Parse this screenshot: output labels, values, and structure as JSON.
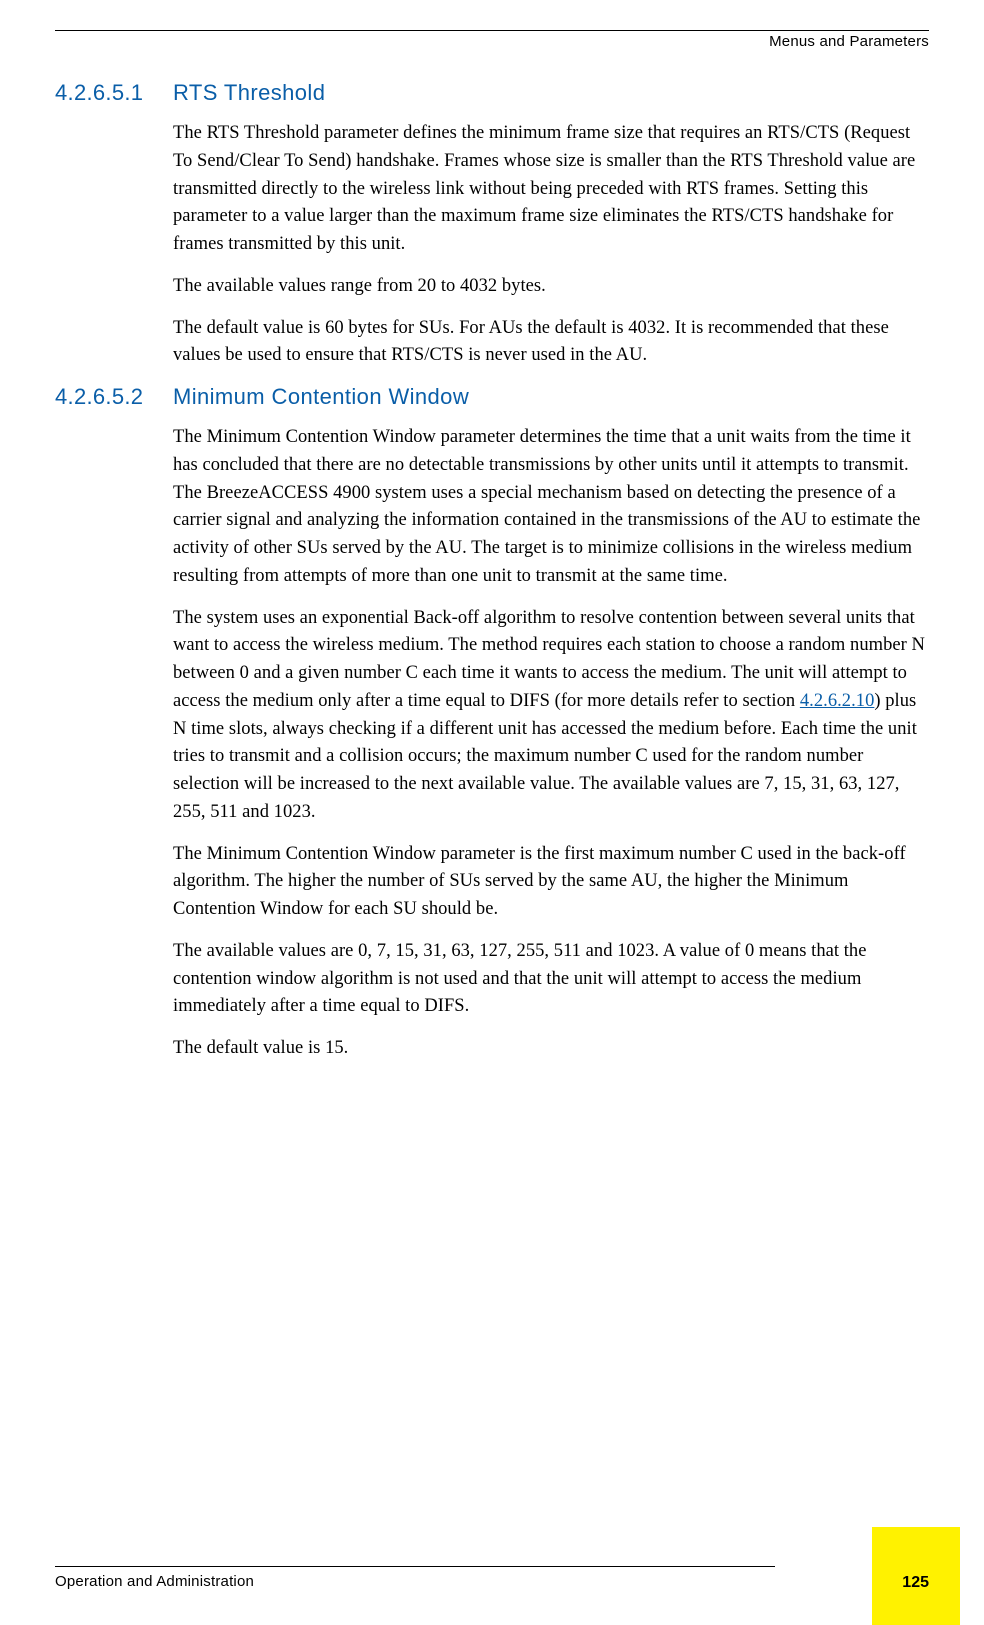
{
  "header": {
    "running_head": "Menus and Parameters"
  },
  "sections": {
    "s1": {
      "num": "4.2.6.5.1",
      "title": "RTS Threshold",
      "p1": "The RTS Threshold parameter defines the minimum frame size that requires an RTS/CTS (Request To Send/Clear To Send) handshake. Frames whose size is smaller than the RTS Threshold value are transmitted directly to the wireless link without being preceded with RTS frames. Setting this parameter to a value larger than the maximum frame size eliminates the RTS/CTS handshake for frames transmitted by this unit.",
      "p2": "The available values range from 20 to 4032 bytes.",
      "p3": "The default value is 60 bytes for SUs. For AUs the default is 4032. It is recommended that these values be used to ensure that RTS/CTS is never used in the AU."
    },
    "s2": {
      "num": "4.2.6.5.2",
      "title": "Minimum Contention Window",
      "p1": "The Minimum Contention Window parameter determines the time that a unit waits from the time it has concluded that there are no detectable transmissions by other units until it attempts to transmit. The BreezeACCESS 4900 system uses a special mechanism based on detecting the presence of a carrier signal and analyzing the information contained in the transmissions of the AU to estimate the activity of other SUs served by the AU. The target is to minimize collisions in the wireless medium resulting from attempts of more than one unit to transmit at the same time.",
      "p2a": "The system uses an exponential Back-off algorithm to resolve contention between several units that want to access the wireless medium. The method requires each station to choose a random number N between 0 and a given number C each time it wants to access the medium. The unit will attempt to access the medium only after a time equal to DIFS (for more details refer to section ",
      "p2_link": "4.2.6.2.10",
      "p2b": ") plus N time slots, always checking if a different unit has accessed the medium before. Each time the unit tries to transmit and a collision occurs; the maximum number C used for the random number selection will be increased to the next available value. The available values are 7, 15, 31, 63, 127, 255, 511 and 1023.",
      "p3": "The Minimum Contention Window parameter is the first maximum number C used in the back-off algorithm. The higher the number of SUs served by the same AU, the higher the Minimum Contention Window for each SU should be.",
      "p4": "The available values are 0, 7, 15, 31, 63, 127, 255, 511 and 1023. A value of 0 means that the contention window algorithm is not used and that the unit will attempt to access the medium immediately after a time equal to DIFS.",
      "p5": "The default value is 15."
    }
  },
  "footer": {
    "text": "Operation and Administration",
    "page": "125"
  }
}
